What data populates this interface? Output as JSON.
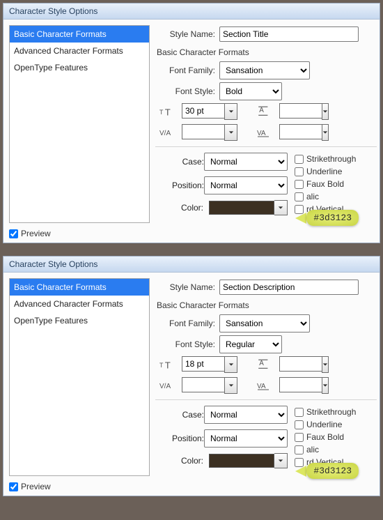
{
  "dialogs": [
    {
      "title": "Character Style Options",
      "sidebar": {
        "items": [
          "Basic Character Formats",
          "Advanced Character Formats",
          "OpenType Features"
        ],
        "selected": 0
      },
      "styleNameLabel": "Style Name:",
      "styleName": "Section Title",
      "sectionLabel": "Basic Character Formats",
      "fontFamilyLabel": "Font Family:",
      "fontFamily": "Sansation",
      "fontStyleLabel": "Font Style:",
      "fontStyle": "Bold",
      "sizeValue": "30 pt",
      "leadingValue": "",
      "kerningValue": "",
      "trackingValue": "",
      "caseLabel": "Case:",
      "caseValue": "Normal",
      "positionLabel": "Position:",
      "positionValue": "Normal",
      "colorLabel": "Color:",
      "colorHex": "#3d3123",
      "checkboxes": {
        "strikethrough": "Strikethrough",
        "underline": "Underline",
        "fauxBold": "Faux Bold",
        "fauxItalic": "alic",
        "vertical": "rd Vertical"
      },
      "callout": "#3d3123",
      "previewLabel": "Preview",
      "previewChecked": true
    },
    {
      "title": "Character Style Options",
      "sidebar": {
        "items": [
          "Basic Character Formats",
          "Advanced Character Formats",
          "OpenType Features"
        ],
        "selected": 0
      },
      "styleNameLabel": "Style Name:",
      "styleName": "Section Description",
      "sectionLabel": "Basic Character Formats",
      "fontFamilyLabel": "Font Family:",
      "fontFamily": "Sansation",
      "fontStyleLabel": "Font Style:",
      "fontStyle": "Regular",
      "sizeValue": "18 pt",
      "leadingValue": "",
      "kerningValue": "",
      "trackingValue": "",
      "caseLabel": "Case:",
      "caseValue": "Normal",
      "positionLabel": "Position:",
      "positionValue": "Normal",
      "colorLabel": "Color:",
      "colorHex": "#3d3123",
      "checkboxes": {
        "strikethrough": "Strikethrough",
        "underline": "Underline",
        "fauxBold": "Faux Bold",
        "fauxItalic": "alic",
        "vertical": "rd Vertical"
      },
      "callout": "#3d3123",
      "previewLabel": "Preview",
      "previewChecked": true
    }
  ]
}
